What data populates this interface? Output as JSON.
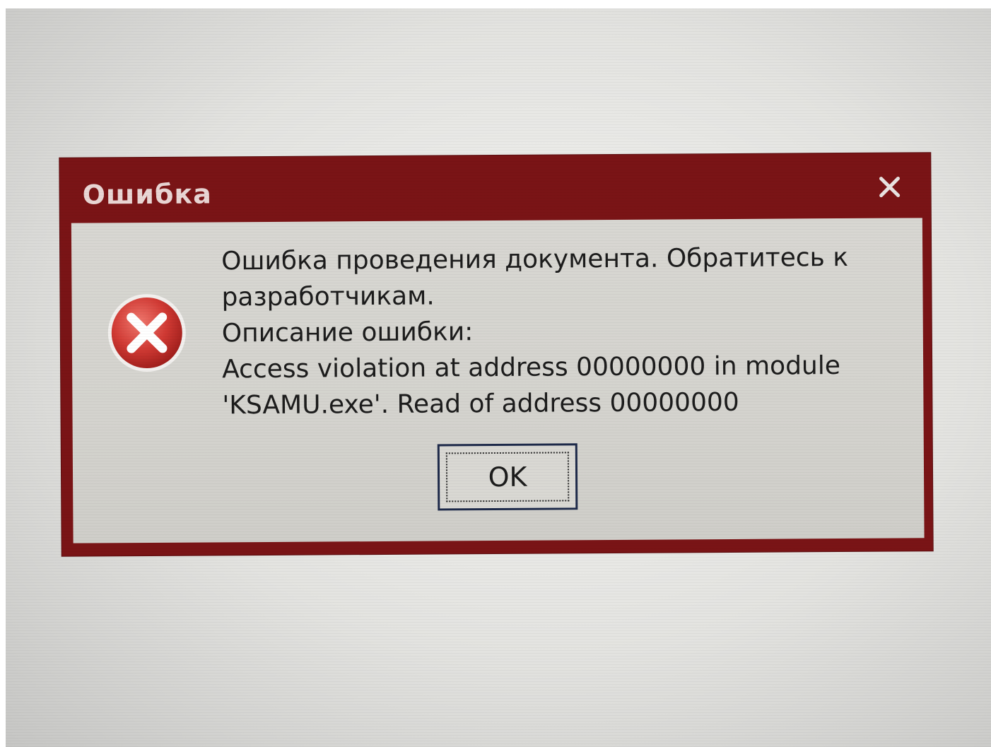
{
  "dialog": {
    "title": "Ошибка",
    "close_icon": "close-icon",
    "error_icon": "error-circle-x-icon",
    "message_lines": [
      "Ошибка проведения документа. Обратитесь к",
      "разработчикам.",
      "Описание ошибки:",
      "Access violation at address 00000000 in module",
      "'KSAMU.exe'. Read of address 00000000"
    ],
    "ok_label": "OK"
  },
  "colors": {
    "frame": "#7a1416",
    "title_text": "#e9d6d4",
    "client_bg": "#d6d5d0",
    "error_red": "#d13a34"
  }
}
